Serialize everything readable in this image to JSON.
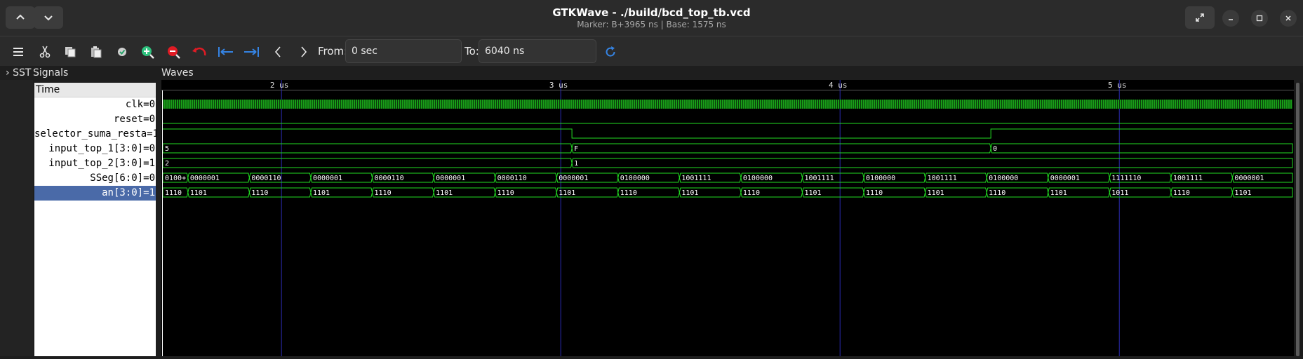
{
  "window": {
    "title": "GTKWave - ./build/bcd_top_tb.vcd",
    "subtitle": "Marker: B+3965 ns  |  Base: 1575 ns"
  },
  "toolbar": {
    "from_label": "From:",
    "from_value": "0 sec",
    "to_label": "To:",
    "to_value": "6040 ns"
  },
  "panels": {
    "sst_label": "SST",
    "signals_title": "Signals",
    "waves_title": "Waves",
    "time_header": "Time"
  },
  "signals": [
    {
      "name": "clk",
      "value": "0",
      "type": "clock"
    },
    {
      "name": "reset",
      "value": "0",
      "type": "bit",
      "level": 0
    },
    {
      "name": "selector_suma_resta",
      "value": "1",
      "type": "bit",
      "level": 1
    },
    {
      "name": "input_top_1[3:0]",
      "value": "0",
      "type": "bus"
    },
    {
      "name": "input_top_2[3:0]",
      "value": "1",
      "type": "bus"
    },
    {
      "name": "SSeg[6:0]",
      "value": "0",
      "type": "bus"
    },
    {
      "name": "an[3:0]",
      "value": "1",
      "type": "bus",
      "selected": true
    }
  ],
  "waves": {
    "ticks": [
      {
        "label": "2 us",
        "t": 2000
      },
      {
        "label": "3 us",
        "t": 3000
      },
      {
        "label": "4 us",
        "t": 4000
      },
      {
        "label": "5 us",
        "t": 5000
      }
    ],
    "selector_suma_resta": [
      {
        "t": 1575,
        "v": 1
      },
      {
        "t": 3040,
        "v": 0
      },
      {
        "t": 4540,
        "v": 1
      }
    ],
    "input_top_1": [
      {
        "t": 1575,
        "label": "5"
      },
      {
        "t": 3040,
        "label": "F"
      },
      {
        "t": 4540,
        "label": "0"
      }
    ],
    "input_top_2": [
      {
        "t": 1575,
        "label": "2"
      },
      {
        "t": 3040,
        "label": "1"
      }
    ],
    "SSeg": [
      {
        "t": 1575,
        "label": "0100+"
      },
      {
        "t": 1665,
        "label": "0000001"
      },
      {
        "t": 1885,
        "label": "0000110"
      },
      {
        "t": 2105,
        "label": "0000001"
      },
      {
        "t": 2325,
        "label": "0000110"
      },
      {
        "t": 2545,
        "label": "0000001"
      },
      {
        "t": 2765,
        "label": "0000110"
      },
      {
        "t": 2985,
        "label": "0000001"
      },
      {
        "t": 3205,
        "label": "0100000"
      },
      {
        "t": 3425,
        "label": "1001111"
      },
      {
        "t": 3645,
        "label": "0100000"
      },
      {
        "t": 3865,
        "label": "1001111"
      },
      {
        "t": 4085,
        "label": "0100000"
      },
      {
        "t": 4305,
        "label": "1001111"
      },
      {
        "t": 4525,
        "label": "0100000"
      },
      {
        "t": 4745,
        "label": "0000001"
      },
      {
        "t": 4965,
        "label": "1111110"
      },
      {
        "t": 5185,
        "label": "1001111"
      },
      {
        "t": 5405,
        "label": "0000001"
      }
    ],
    "an": [
      {
        "t": 1575,
        "label": "1110"
      },
      {
        "t": 1665,
        "label": "1101"
      },
      {
        "t": 1885,
        "label": "1110"
      },
      {
        "t": 2105,
        "label": "1101"
      },
      {
        "t": 2325,
        "label": "1110"
      },
      {
        "t": 2545,
        "label": "1101"
      },
      {
        "t": 2765,
        "label": "1110"
      },
      {
        "t": 2985,
        "label": "1101"
      },
      {
        "t": 3205,
        "label": "1110"
      },
      {
        "t": 3425,
        "label": "1101"
      },
      {
        "t": 3645,
        "label": "1110"
      },
      {
        "t": 3865,
        "label": "1101"
      },
      {
        "t": 4085,
        "label": "1110"
      },
      {
        "t": 4305,
        "label": "1101"
      },
      {
        "t": 4525,
        "label": "1110"
      },
      {
        "t": 4745,
        "label": "1101"
      },
      {
        "t": 4965,
        "label": "1011"
      },
      {
        "t": 5185,
        "label": "1110"
      },
      {
        "t": 5405,
        "label": "1101"
      }
    ]
  },
  "colors": {
    "wave": "#22dd22",
    "grid": "#2a2ab0",
    "selection": "#4a6aa8",
    "zoom_in": "#2ec27e",
    "zoom_out": "#e01b24",
    "undo": "#e01b24",
    "nav": "#3584e4"
  },
  "icons": [
    "chevron-up-icon",
    "chevron-down-icon",
    "menu-icon",
    "cut-icon",
    "copy-icon",
    "paste-icon",
    "select-all-icon",
    "zoom-in-icon",
    "zoom-out-icon",
    "undo-icon",
    "zoom-begin-icon",
    "zoom-end-icon",
    "prev-icon",
    "next-icon",
    "reload-icon",
    "fullscreen-icon",
    "minimize-icon",
    "maximize-icon",
    "close-icon"
  ]
}
